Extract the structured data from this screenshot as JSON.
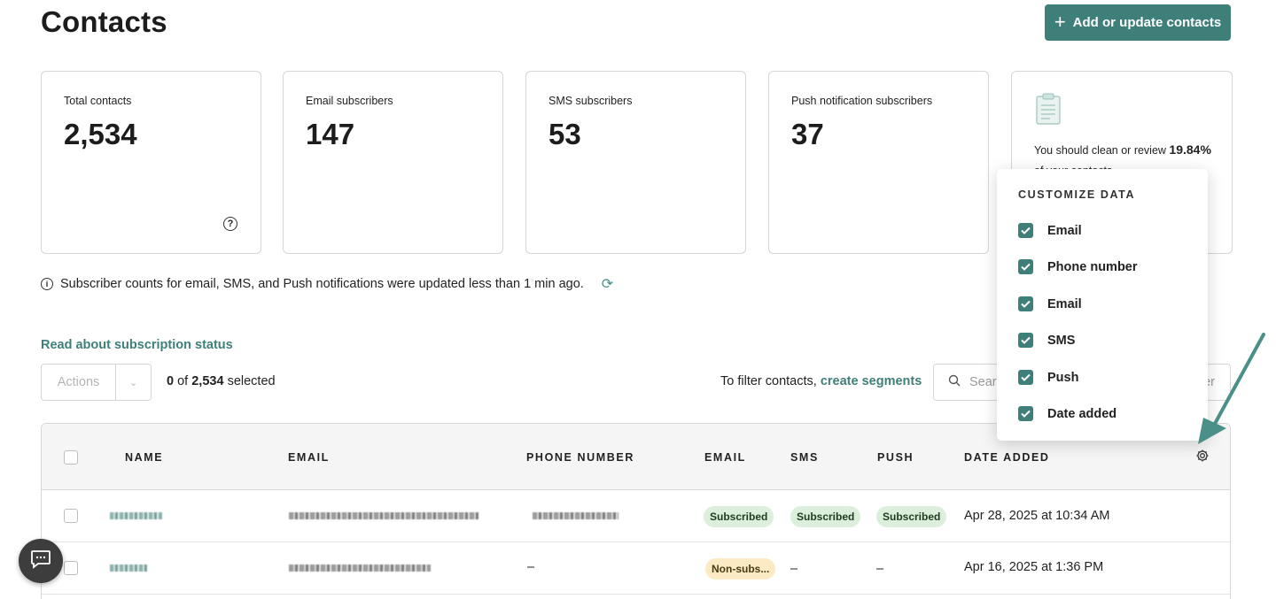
{
  "header": {
    "title": "Contacts",
    "add_button": "Add or update contacts"
  },
  "stats": [
    {
      "label": "Total contacts",
      "value": "2,534"
    },
    {
      "label": "Email subscribers",
      "value": "147"
    },
    {
      "label": "SMS subscribers",
      "value": "53"
    },
    {
      "label": "Push notification subscribers",
      "value": "37"
    }
  ],
  "clean_card": {
    "text_before": "You should clean or review ",
    "percent": "19.84%",
    "text_after": "of your contacts"
  },
  "info": {
    "message": "Subscriber counts for email, SMS, and Push notifications were updated less than 1 min ago."
  },
  "read_link": "Read about subscription status",
  "toolbar": {
    "actions_label": "Actions",
    "selected_count": "0",
    "selected_of": "of",
    "selected_total": "2,534",
    "selected_suffix": "selected",
    "filter_prefix": "To filter contacts,",
    "filter_link": "create segments",
    "search_placeholder": "Sear",
    "search_tail": "er"
  },
  "table": {
    "columns": [
      "NAME",
      "EMAIL",
      "PHONE NUMBER",
      "EMAIL",
      "SMS",
      "PUSH",
      "DATE ADDED"
    ],
    "rows": [
      {
        "phone": "",
        "email_status": "Subscribed",
        "sms_status": "Subscribed",
        "push_status": "Subscribed",
        "date_added": "Apr 28, 2025 at 10:34 AM"
      },
      {
        "phone": "–",
        "email_status": "Non-subs...",
        "sms_status": "–",
        "push_status": "–",
        "date_added": "Apr 16, 2025 at 1:36 PM"
      }
    ]
  },
  "customize": {
    "title": "CUSTOMIZE DATA",
    "items": [
      "Email",
      "Phone number",
      "Email",
      "SMS",
      "Push",
      "Date added"
    ]
  },
  "colors": {
    "accent": "#3f7f79",
    "subscribed_bg": "#dcefdc",
    "non_subscribed_bg": "#fbeac4"
  },
  "icons": [
    "plus-icon",
    "help-icon",
    "clipboard-icon",
    "info-icon",
    "refresh-icon",
    "chevron-down-icon",
    "search-icon",
    "gear-icon",
    "check-icon",
    "arrow-annotation",
    "chat-icon"
  ]
}
